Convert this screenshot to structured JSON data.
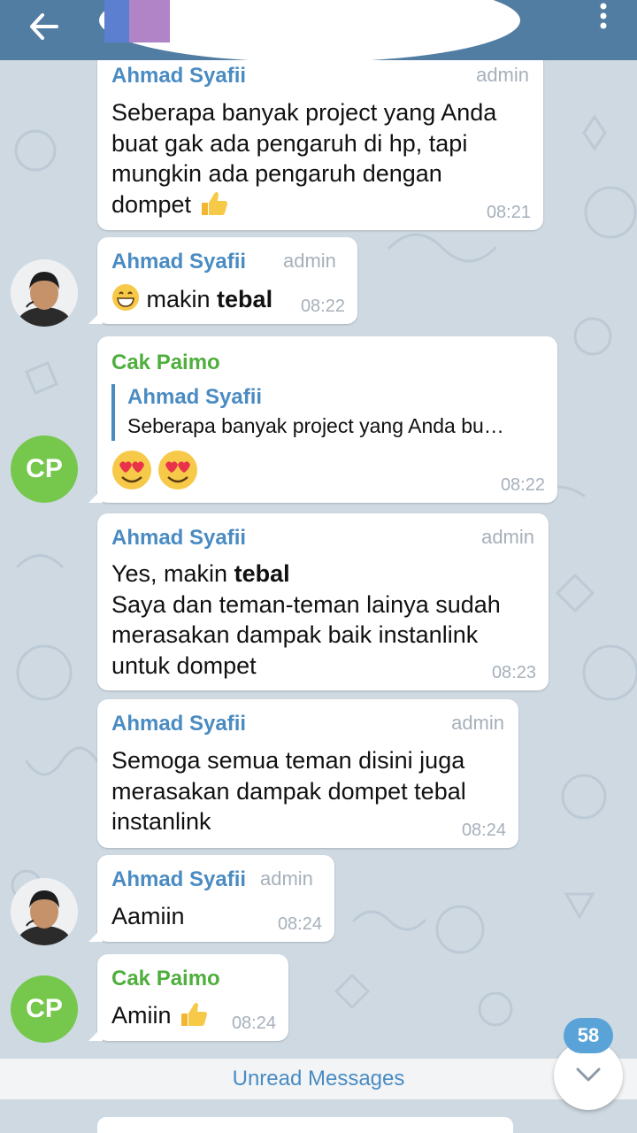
{
  "header": {
    "back_icon": "arrow-left-icon",
    "menu_icon": "more-vertical-icon",
    "background_color": "#517da2"
  },
  "messages": [
    {
      "sender": "Ahmad Syafii",
      "role": "admin",
      "lines": [
        "Seberapa banyak project yang Anda",
        "buat gak ada pengaruh di hp, tapi",
        "mungkin ada pengaruh dengan",
        "dompet"
      ],
      "emoji": "thumbs-up-icon",
      "time": "08:21"
    },
    {
      "sender": "Ahmad Syafii",
      "role": "admin",
      "emoji": "grinning-face-icon",
      "text_plain": "makin ",
      "text_bold": "tebal",
      "time": "08:22"
    },
    {
      "sender": "Cak Paimo",
      "avatar_initials": "CP",
      "reply": {
        "sender": "Ahmad Syafii",
        "text": "Seberapa banyak project yang Anda bu…"
      },
      "emoji": "heart-eyes-icon",
      "time": "08:22"
    },
    {
      "sender": "Ahmad Syafii",
      "role": "admin",
      "line1_plain": "Yes, makin ",
      "line1_bold": "tebal",
      "lines": [
        "Saya dan teman-teman lainya sudah",
        "merasakan dampak baik instanlink",
        "untuk dompet"
      ],
      "time": "08:23"
    },
    {
      "sender": "Ahmad Syafii",
      "role": "admin",
      "lines": [
        "Semoga semua teman disini juga",
        "merasakan dampak dompet tebal",
        "instanlink"
      ],
      "time": "08:24"
    },
    {
      "sender": "Ahmad Syafii",
      "role": "admin",
      "text": "Aamiin",
      "time": "08:24"
    },
    {
      "sender": "Cak Paimo",
      "avatar_initials": "CP",
      "text": "Amiin",
      "emoji": "thumbs-up-icon",
      "time": "08:24"
    }
  ],
  "unread": {
    "label": "Unread Messages",
    "count": "58",
    "scroll_icon": "chevron-down-icon"
  },
  "colors": {
    "admin_name": "#4a8bc2",
    "member_name": "#4fae3d",
    "avatar_cp": "#76c84d",
    "chat_background": "#cfd9e2"
  }
}
